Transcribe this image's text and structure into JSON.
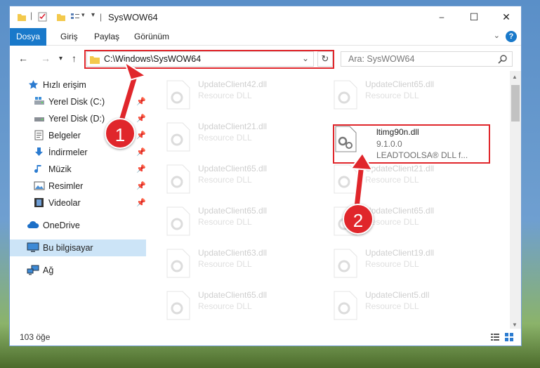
{
  "window": {
    "title": "SysWOW64",
    "controls": {
      "minimize": "–",
      "maximize": "☐",
      "close": "✕"
    }
  },
  "ribbon": {
    "tabs": [
      "Dosya",
      "Giriş",
      "Paylaş",
      "Görünüm"
    ],
    "help": "?"
  },
  "nav": {
    "back": "←",
    "forward": "→",
    "recent": "▾",
    "up": "↑",
    "address": "C:\\Windows\\SysWOW64",
    "refresh": "↻",
    "search_placeholder": "Ara: SysWOW64"
  },
  "sidebar": {
    "items": [
      {
        "label": "Hızlı erişim",
        "icon": "star-icon"
      },
      {
        "label": "Yerel Disk (C:)",
        "icon": "drive-icon",
        "pinned": true
      },
      {
        "label": "Yerel Disk (D:)",
        "icon": "drive-icon",
        "pinned": true
      },
      {
        "label": "Belgeler",
        "icon": "documents-icon",
        "pinned": true
      },
      {
        "label": "İndirmeler",
        "icon": "download-icon",
        "pinned": true
      },
      {
        "label": "Müzik",
        "icon": "music-icon",
        "pinned": true
      },
      {
        "label": "Resimler",
        "icon": "pictures-icon",
        "pinned": true
      },
      {
        "label": "Videolar",
        "icon": "videos-icon",
        "pinned": true
      },
      {
        "label": "OneDrive",
        "icon": "cloud-icon"
      },
      {
        "label": "Bu bilgisayar",
        "icon": "computer-icon",
        "selected": true
      },
      {
        "label": "Ağ",
        "icon": "network-icon"
      }
    ]
  },
  "files": [
    {
      "name": "UpdateClient42.dll",
      "type": "Resource DLL",
      "faded": true
    },
    {
      "name": "UpdateClient65.dll",
      "type": "Resource DLL",
      "faded": true
    },
    {
      "name": "UpdateClient21.dll",
      "type": "Resource DLL",
      "faded": true
    },
    {
      "name": "ltimg90n.dll",
      "version": "9.1.0.0",
      "description": "LEADTOOLSA® DLL f...",
      "faded": false
    },
    {
      "name": "UpdateClient65.dll",
      "type": "Resource DLL",
      "faded": true
    },
    {
      "name": "UpdateClient21.dll",
      "type": "Resource DLL",
      "faded": true
    },
    {
      "name": "UpdateClient65.dll",
      "type": "Resource DLL",
      "faded": true
    },
    {
      "name": "UpdateClient65.dll",
      "type": "Resource DLL",
      "faded": true
    },
    {
      "name": "UpdateClient63.dll",
      "type": "Resource DLL",
      "faded": true
    },
    {
      "name": "UpdateClient19.dll",
      "type": "Resource DLL",
      "faded": true
    },
    {
      "name": "UpdateClient65.dll",
      "type": "Resource DLL",
      "faded": true
    },
    {
      "name": "UpdateClient5.dll",
      "type": "Resource DLL",
      "faded": true
    }
  ],
  "status": {
    "count": "103 öğe"
  },
  "annotations": {
    "marker1": "1",
    "marker2": "2"
  },
  "colors": {
    "accent": "#1979ca",
    "highlight": "#e0262b",
    "selected": "#cce4f7"
  }
}
